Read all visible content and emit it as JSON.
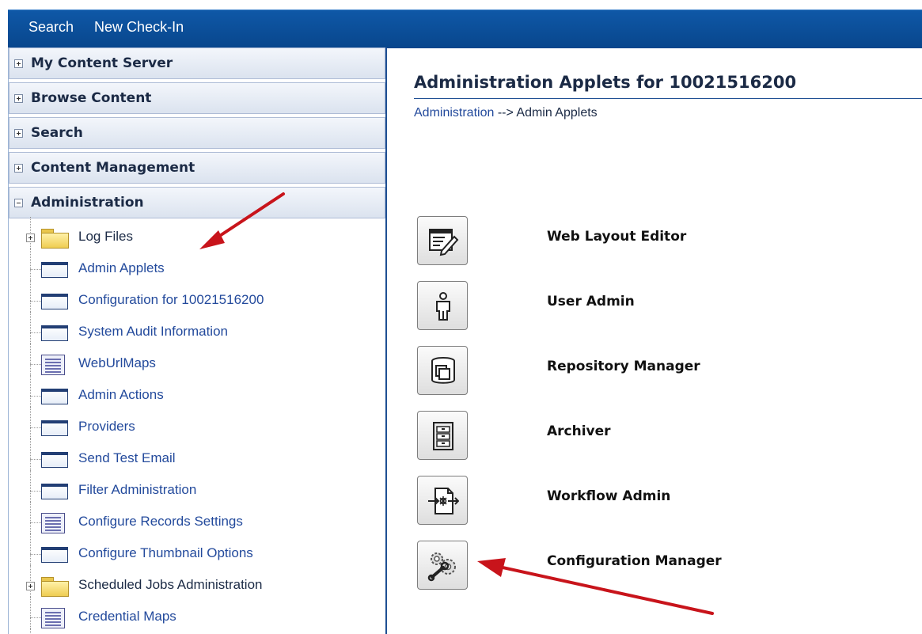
{
  "topnav": {
    "items": [
      {
        "label": "Search"
      },
      {
        "label": "New Check-In"
      }
    ]
  },
  "sidebar": {
    "panels": [
      {
        "label": "My Content Server",
        "state": "collapsed"
      },
      {
        "label": "Browse Content",
        "state": "collapsed"
      },
      {
        "label": "Search",
        "state": "collapsed"
      },
      {
        "label": "Content Management",
        "state": "collapsed"
      },
      {
        "label": "Administration",
        "state": "expanded"
      }
    ],
    "admin_tree": [
      {
        "label": "Log Files",
        "icon": "folder-icon",
        "expandable": true
      },
      {
        "label": "Admin Applets",
        "icon": "page-icon"
      },
      {
        "label": "Configuration for 10021516200",
        "icon": "page-icon"
      },
      {
        "label": "System Audit Information",
        "icon": "page-icon"
      },
      {
        "label": "WebUrlMaps",
        "icon": "document-icon"
      },
      {
        "label": "Admin Actions",
        "icon": "page-icon"
      },
      {
        "label": "Providers",
        "icon": "page-icon"
      },
      {
        "label": "Send Test Email",
        "icon": "page-icon"
      },
      {
        "label": "Filter Administration",
        "icon": "page-icon"
      },
      {
        "label": "Configure Records Settings",
        "icon": "document-icon"
      },
      {
        "label": "Configure Thumbnail Options",
        "icon": "page-icon"
      },
      {
        "label": "Scheduled Jobs Administration",
        "icon": "folder-icon",
        "expandable": true
      },
      {
        "label": "Credential Maps",
        "icon": "document-icon"
      }
    ]
  },
  "main": {
    "title": "Administration Applets for 10021516200",
    "breadcrumb": {
      "link": "Administration",
      "separator": " --> ",
      "current": "Admin Applets"
    },
    "applets": [
      {
        "label": "Web Layout Editor",
        "icon": "web-layout-editor-icon"
      },
      {
        "label": "User Admin",
        "icon": "user-admin-icon"
      },
      {
        "label": "Repository Manager",
        "icon": "repository-manager-icon"
      },
      {
        "label": "Archiver",
        "icon": "archiver-icon"
      },
      {
        "label": "Workflow Admin",
        "icon": "workflow-admin-icon"
      },
      {
        "label": "Configuration Manager",
        "icon": "configuration-manager-icon"
      }
    ]
  },
  "colors": {
    "nav_blue": "#0f58a7",
    "link_blue": "#234a9c",
    "annotation_red": "#c8141b"
  }
}
